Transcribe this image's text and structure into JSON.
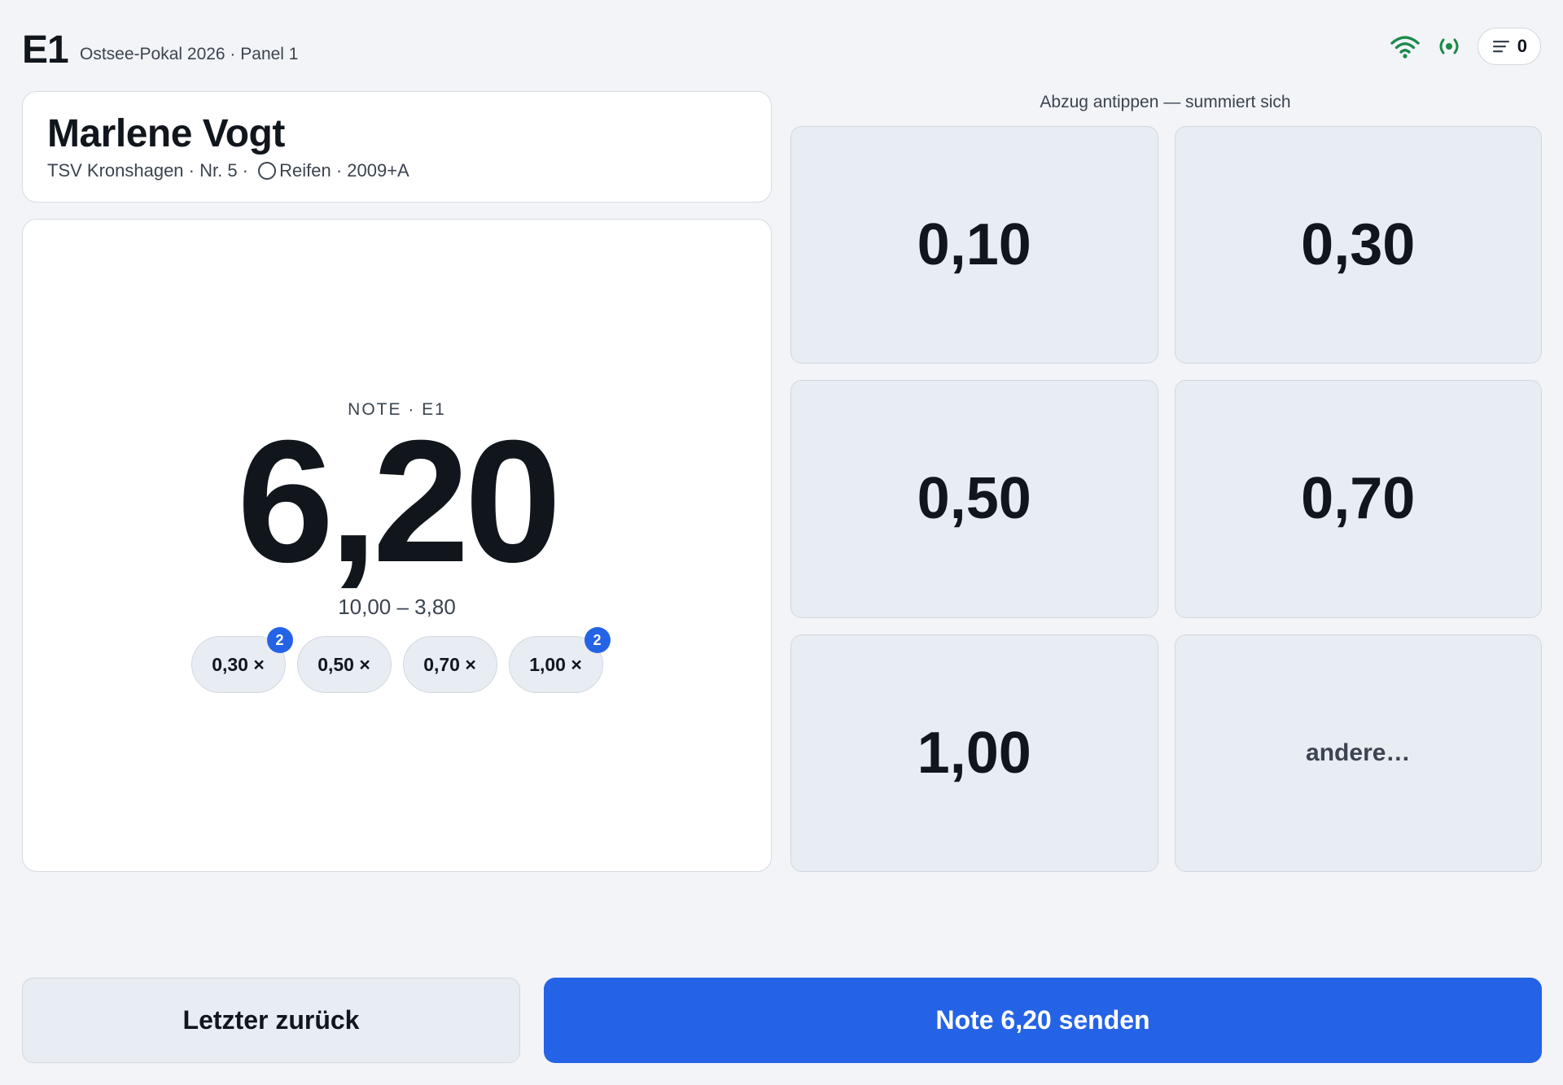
{
  "header": {
    "panel_id": "E1",
    "subtitle": "Ostsee-Pokal 2026 · Panel 1",
    "queue_count": "0",
    "icons": [
      "wifi-icon",
      "live-icon",
      "queue-icon"
    ],
    "status_color": "#1b8a4a"
  },
  "athlete": {
    "name": "Marlene Vogt",
    "meta_prefix": "TSV Kronshagen · Nr. 5 · ",
    "apparatus": "Reifen",
    "meta_suffix": " · 2009+A"
  },
  "score": {
    "label": "NOTE · E1",
    "value": "6,20",
    "formula": "10,00 – 3,80",
    "chips": [
      {
        "label": "0,30 ×",
        "count": "2"
      },
      {
        "label": "0,50 ×",
        "count": null
      },
      {
        "label": "0,70 ×",
        "count": null
      },
      {
        "label": "1,00 ×",
        "count": "2"
      }
    ]
  },
  "deductions": {
    "hint": "Abzug antippen — summiert sich",
    "buttons": [
      "0,10",
      "0,30",
      "0,50",
      "0,70",
      "1,00"
    ],
    "other_label": "andere…"
  },
  "actions": {
    "back_label": "Letzter zurück",
    "send_label": "Note 6,20 senden"
  },
  "colors": {
    "accent": "#2563e6",
    "background": "#f2f4f8",
    "tile": "#e8ecf3"
  }
}
